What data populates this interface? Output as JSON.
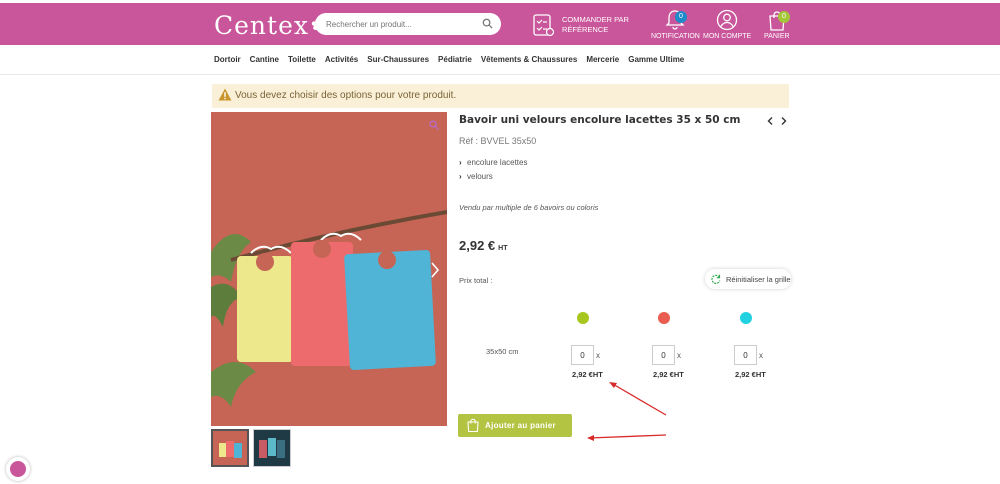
{
  "header": {
    "logo": "Centex",
    "search_placeholder": "Rechercher un produit...",
    "order_by_ref": "Commander par référence",
    "notification_label": "Notification",
    "notification_count": "0",
    "account_label": "Mon compte",
    "cart_label": "Panier",
    "cart_count": "0",
    "colors": {
      "brand": "#c9559b",
      "badge_blue": "#1f8ac9",
      "badge_green": "#a4c639"
    },
    "icons": [
      "search-icon",
      "checklist-icon",
      "bell-icon",
      "user-icon",
      "shopping-bag-icon"
    ]
  },
  "nav": {
    "items": [
      "Dortoir",
      "Cantine",
      "Toilette",
      "Activités",
      "Sur-Chaussures",
      "Pédiatrie",
      "Vêtements & Chaussures",
      "Mercerie",
      "Gamme Ultime"
    ]
  },
  "alert": {
    "message": "Vous devez choisir des options pour votre produit.",
    "icon": "warning-icon"
  },
  "product": {
    "title": "Bavoir uni velours encolure lacettes 35 x 50 cm",
    "reference": "Réf : BVVEL 35x50",
    "attributes": [
      "encolure lacettes",
      "velours"
    ],
    "sold_by": "Vendu par multiple de 6 bavoirs ou coloris",
    "price": "2,92 €",
    "price_suffix": "HT",
    "total_label": "Prix total :",
    "reset_label": "Réinitialiser la grille",
    "size_label": "35x50 cm",
    "variants": [
      {
        "color": "#a7c71f",
        "qty": "0",
        "multiplier": "x",
        "unit_price": "2,92 €HT"
      },
      {
        "color": "#ea5c4f",
        "qty": "0",
        "multiplier": "x",
        "unit_price": "2,92 €HT"
      },
      {
        "color": "#22d1e0",
        "qty": "0",
        "multiplier": "x",
        "unit_price": "2,92 €HT"
      }
    ],
    "add_to_cart": "Ajouter au panier",
    "add_to_cart_color": "#b2c441"
  }
}
